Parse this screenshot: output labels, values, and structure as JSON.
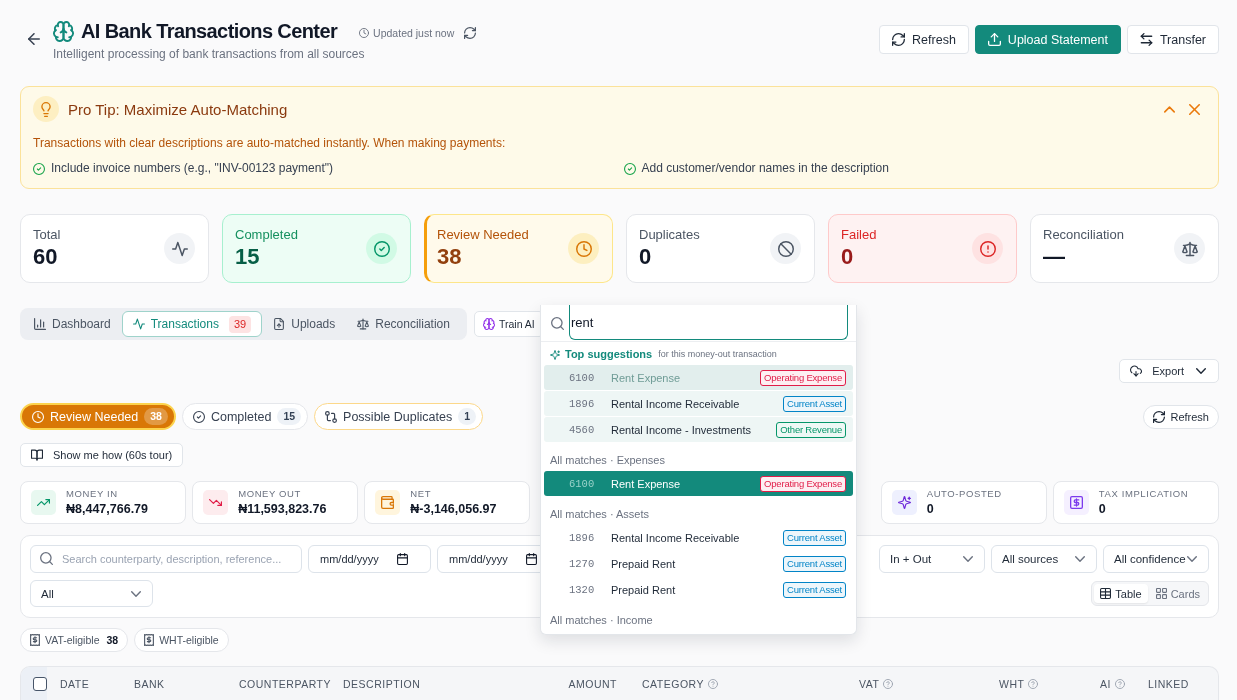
{
  "header": {
    "title": "AI Bank Transactions Center",
    "subtitle": "Intelligent processing of bank transactions from all sources",
    "updated": "Updated just now",
    "actions": [
      {
        "label": "Refresh",
        "kind": "secondary"
      },
      {
        "label": "Upload Statement",
        "kind": "primary"
      },
      {
        "label": "Transfer",
        "kind": "secondary"
      }
    ]
  },
  "tip": {
    "title": "Pro Tip: Maximize Auto-Matching",
    "expanded": true,
    "text": "Transactions with clear descriptions are auto-matched instantly. When making payments:",
    "points": [
      "Include invoice numbers (e.g., \"INV-00123 payment\")",
      "Add customer/vendor names in the description"
    ]
  },
  "stats": [
    {
      "label": "Total",
      "value": "60",
      "kind": "neutral"
    },
    {
      "label": "Completed",
      "value": "15",
      "kind": "success"
    },
    {
      "label": "Review Needed",
      "value": "38",
      "kind": "warning"
    },
    {
      "label": "Duplicates",
      "value": "0",
      "kind": "neutral"
    },
    {
      "label": "Failed",
      "value": "0",
      "kind": "danger"
    },
    {
      "label": "Reconciliation",
      "value": "—",
      "kind": "neutral"
    }
  ],
  "tabs": [
    {
      "label": "Dashboard",
      "selected": false
    },
    {
      "label": "Transactions",
      "selected": true,
      "count": "39"
    },
    {
      "label": "Uploads",
      "selected": false
    },
    {
      "label": "Reconciliation",
      "selected": false
    }
  ],
  "train_button": "Train AI",
  "export_button": "Export",
  "status_filters": [
    {
      "label": "Review Needed",
      "count": "38",
      "selected": true,
      "kind": "warning"
    },
    {
      "label": "Completed",
      "count": "15",
      "selected": false,
      "kind": "neutral"
    },
    {
      "label": "Possible Duplicates",
      "count": "1",
      "selected": false,
      "kind": "warning"
    }
  ],
  "refresh_button": "Refresh",
  "tour_button": "Show me how (60s tour)",
  "summary": [
    {
      "label": "MONEY IN",
      "value": "₦8,447,766.79"
    },
    {
      "label": "MONEY OUT",
      "value": "₦11,593,823.76"
    },
    {
      "label": "NET",
      "value": "₦-3,146,056.97"
    },
    {
      "label": "AUTO-POSTED",
      "value": "0"
    },
    {
      "label": "TAX IMPLICATION",
      "value": "0"
    }
  ],
  "filters": {
    "search": {
      "placeholder": "Search counterparty, description, reference..."
    },
    "dates": [
      {
        "placeholder": "mm/dd/yyyy"
      },
      {
        "placeholder": "mm/dd/yyyy"
      }
    ],
    "selects": [
      {
        "value": "In + Out"
      },
      {
        "value": "All sources"
      },
      {
        "value": "All confidence"
      }
    ],
    "type_select": {
      "value": "All"
    },
    "views": [
      {
        "label": "Table",
        "selected": true
      },
      {
        "label": "Cards",
        "selected": false
      }
    ]
  },
  "tax_chips": [
    {
      "label": "VAT-eligible",
      "count": "38"
    },
    {
      "label": "WHT-eligible"
    }
  ],
  "table": {
    "select_all": {
      "checked": false
    },
    "columns": [
      {
        "label": "DATE",
        "help": false
      },
      {
        "label": "BANK",
        "help": false
      },
      {
        "label": "COUNTERPARTY",
        "help": false
      },
      {
        "label": "DESCRIPTION",
        "help": false
      },
      {
        "label": "AMOUNT",
        "help": false
      },
      {
        "label": "CATEGORY",
        "help": true
      },
      {
        "label": "VAT",
        "help": true
      },
      {
        "label": "WHT",
        "help": true
      },
      {
        "label": "AI",
        "help": true
      },
      {
        "label": "LINKED",
        "help": false
      }
    ]
  },
  "account_picker": {
    "query": "rent",
    "sections": [
      {
        "title": "Top suggestions",
        "subtitle": "for this money-out transaction",
        "kind": "suggested",
        "items": [
          {
            "code": "6100",
            "name": "Rent Expense",
            "type": "Operating Expense",
            "color": "#e11d48",
            "selected": true
          },
          {
            "code": "1896",
            "name": "Rental Income Receivable",
            "type": "Current Asset",
            "color": "#0284c7",
            "selected": false
          },
          {
            "code": "4560",
            "name": "Rental Income - Investments",
            "type": "Other Revenue",
            "color": "#059669",
            "selected": false
          }
        ]
      },
      {
        "title": "All matches · Expenses",
        "kind": "matches",
        "items": [
          {
            "code": "6100",
            "name": "Rent Expense",
            "type": "Operating Expense",
            "color": "#e11d48",
            "selected": true
          }
        ]
      },
      {
        "title": "All matches · Assets",
        "kind": "matches",
        "items": [
          {
            "code": "1896",
            "name": "Rental Income Receivable",
            "type": "Current Asset",
            "color": "#0284c7",
            "selected": false
          },
          {
            "code": "1270",
            "name": "Prepaid Rent",
            "type": "Current Asset",
            "color": "#0284c7",
            "selected": false
          },
          {
            "code": "1320",
            "name": "Prepaid Rent",
            "type": "Current Asset",
            "color": "#0284c7",
            "selected": false
          }
        ]
      },
      {
        "title": "All matches · Income",
        "kind": "matches"
      }
    ]
  }
}
